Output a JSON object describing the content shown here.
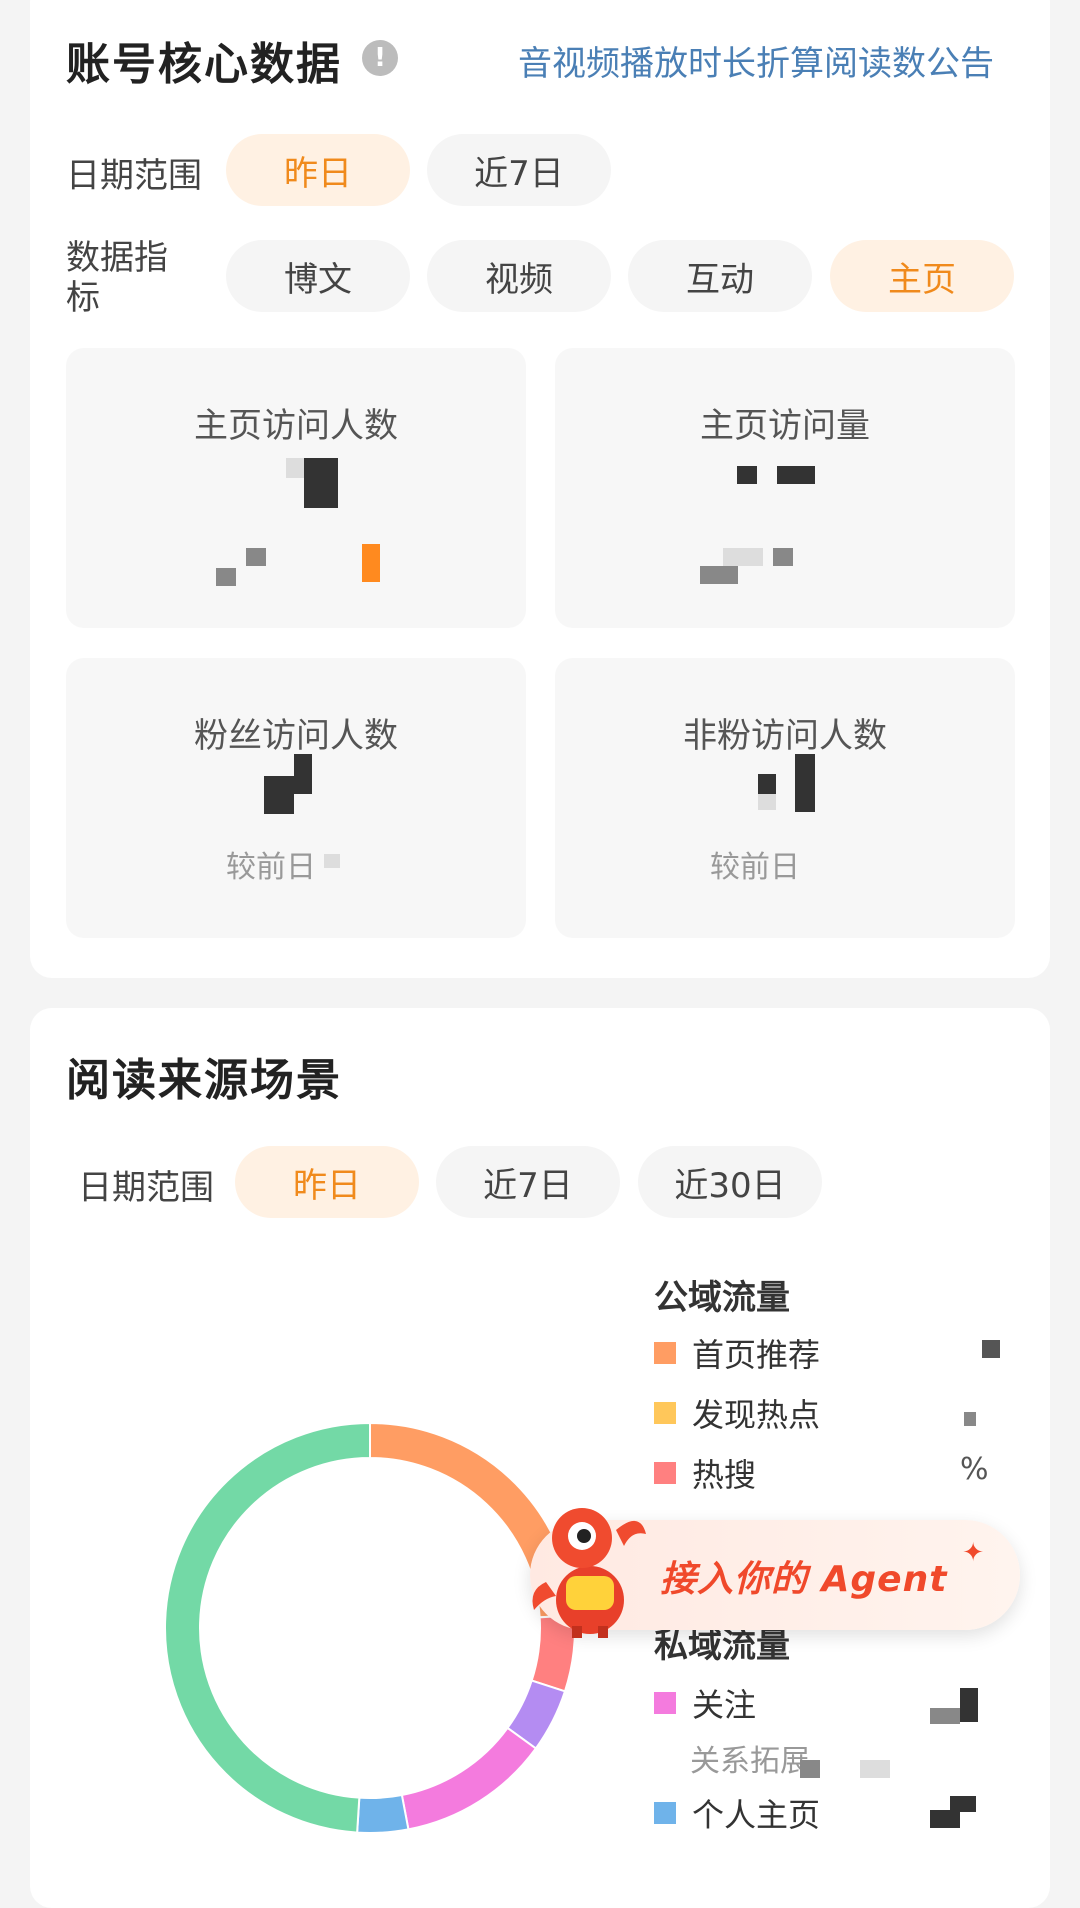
{
  "core": {
    "title": "账号核心数据",
    "info_icon": "!",
    "notice_link": "音视频播放时长折算阅读数公告",
    "date_range_label": "日期范围",
    "date_options": [
      "昨日",
      "近7日"
    ],
    "metric_label": "数据指标",
    "metric_options": [
      "博文",
      "视频",
      "互动",
      "主页"
    ],
    "stats": [
      {
        "label": "主页访问人数",
        "sub": ""
      },
      {
        "label": "主页访问量",
        "sub": ""
      },
      {
        "label": "粉丝访问人数",
        "sub": "较前日"
      },
      {
        "label": "非粉访问人数",
        "sub": "较前日"
      }
    ]
  },
  "source": {
    "title": "阅读来源场景",
    "date_range_label": "日期范围",
    "date_options": [
      "昨日",
      "近7日",
      "近30日"
    ],
    "public_group": "公域流量",
    "public_items": [
      {
        "label": "首页推荐",
        "color": "#ff9d63",
        "value": ""
      },
      {
        "label": "发现热点",
        "color": "#ffc75a",
        "value": ""
      },
      {
        "label": "热搜",
        "color": "#ff8080",
        "value": "%"
      }
    ],
    "private_group": "私域流量",
    "private_items": [
      {
        "label": "关注",
        "color": "#f47bde",
        "sub": "关系拓展"
      },
      {
        "label": "个人主页",
        "color": "#6fb3ea",
        "sub": ""
      }
    ]
  },
  "agent_badge": {
    "text": "接入你的 Agent",
    "sparkle": "✦"
  },
  "chart_data": {
    "type": "pie",
    "categories": [
      "首页推荐",
      "热搜",
      "未标注(紫)",
      "关注",
      "个人主页",
      "其他(绿)"
    ],
    "values": [
      24,
      6,
      5,
      12,
      4,
      49
    ],
    "colors": [
      "#ff9d63",
      "#ff8080",
      "#b48cf2",
      "#f47bde",
      "#6fb3ea",
      "#73d9a6"
    ]
  }
}
